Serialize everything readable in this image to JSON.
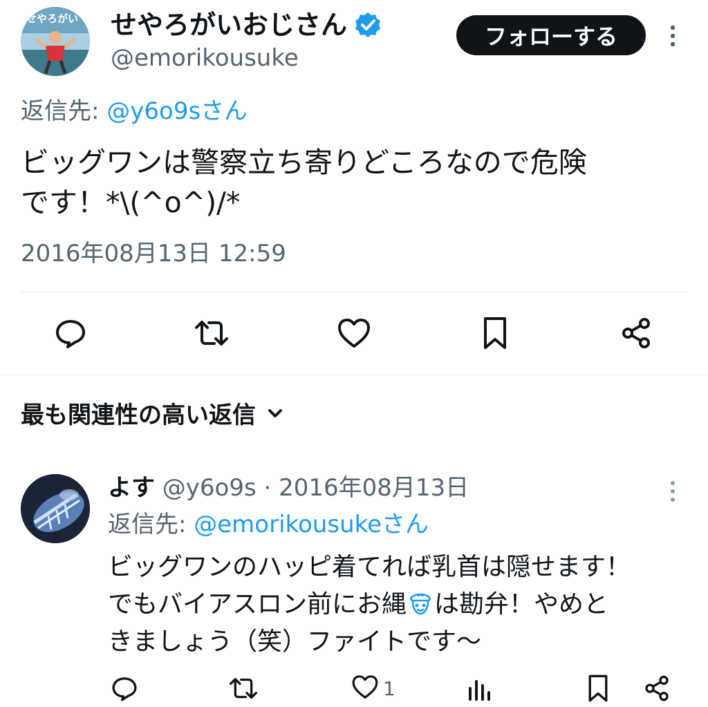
{
  "main_tweet": {
    "display_name": "せやろがいおじさん",
    "handle": "@emorikousuke",
    "follow_label": "フォローする",
    "reply_to_prefix": "返信先: ",
    "reply_to_mention": "@y6o9sさん",
    "text": "ビッグワンは警察立ち寄りどころなので危険\nです！*\\(^o^)/*",
    "timestamp": "2016年08月13日 12:59",
    "avatar_text": "せやろがい",
    "actions": [
      "reply-icon",
      "retweet-icon",
      "like-icon",
      "bookmark-icon",
      "share-icon"
    ]
  },
  "replies_section": {
    "sort_label": "最も関連性の高い返信"
  },
  "reply": {
    "name": "よす",
    "meta": " @y6o9s · 2016年08月13日",
    "reply_to_prefix": "返信先: ",
    "reply_to_mention": "@emorikousukeさん",
    "line1": "ビッグワンのハッピ着てれば乳首は隠せます！",
    "line2_before": "でもバイアスロン前にお縄",
    "line2_after": "は勘弁！やめと",
    "line3": "きましょう（笑）ファイトです〜",
    "like_count": "1",
    "actions": [
      "reply-icon",
      "retweet-icon",
      "like-icon",
      "views-icon",
      "bookmark-icon",
      "share-icon"
    ]
  },
  "colors": {
    "text": "#0f1419",
    "secondary": "#536471",
    "link": "#1d9bf0",
    "follow_bg": "#0f1419",
    "verified": "#1d9bf0"
  }
}
